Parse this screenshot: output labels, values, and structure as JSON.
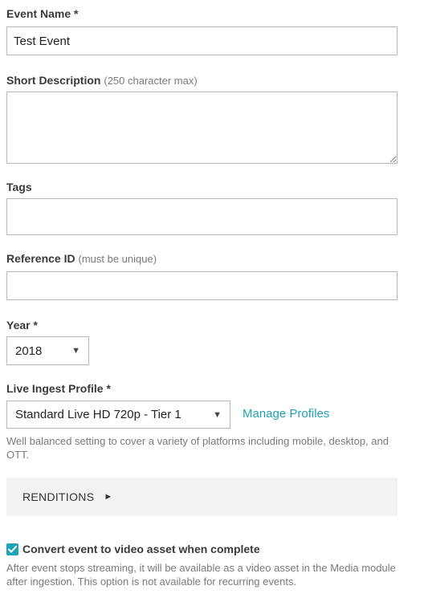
{
  "event_name": {
    "label": "Event Name",
    "required_mark": "*",
    "value": "Test Event"
  },
  "short_description": {
    "label": "Short Description",
    "hint": "(250 character max)",
    "value": ""
  },
  "tags": {
    "label": "Tags",
    "value": ""
  },
  "reference_id": {
    "label": "Reference ID",
    "hint": "(must be unique)",
    "value": ""
  },
  "year": {
    "label": "Year",
    "required_mark": "*",
    "selected": "2018",
    "caret": "▼"
  },
  "ingest_profile": {
    "label": "Live Ingest Profile",
    "required_mark": "*",
    "selected": "Standard Live HD 720p - Tier 1",
    "caret": "▼",
    "manage_link": "Manage Profiles",
    "help": "Well balanced setting to cover a variety of platforms including mobile, desktop, and OTT."
  },
  "renditions": {
    "label": "RENDITIONS",
    "toggle": "►"
  },
  "convert": {
    "checked": true,
    "label": "Convert event to video asset when complete",
    "help": "After event stops streaming, it will be available as a video asset in the Media module after ingestion. This option is not available for recurring events."
  },
  "colors": {
    "accent": "#1fa3b5",
    "panel": "#f2f2f2",
    "border": "#b8b8b8"
  }
}
